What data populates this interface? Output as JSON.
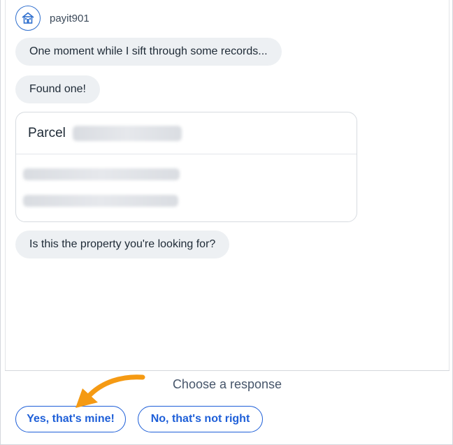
{
  "bot": {
    "name": "payit901",
    "icon": "house-icon"
  },
  "messages": [
    {
      "text": "One moment while I sift through some records..."
    },
    {
      "text": "Found one!"
    },
    {
      "text": "Is this the property you're looking for?"
    }
  ],
  "parcel_card": {
    "title": "Parcel"
  },
  "footer": {
    "prompt": "Choose a response",
    "options": [
      {
        "label": "Yes, that's mine!"
      },
      {
        "label": "No, that's not right"
      }
    ]
  },
  "colors": {
    "accent": "#1e5fd8",
    "bubble_bg": "#edf0f3",
    "annotation_arrow": "#f59a13"
  }
}
